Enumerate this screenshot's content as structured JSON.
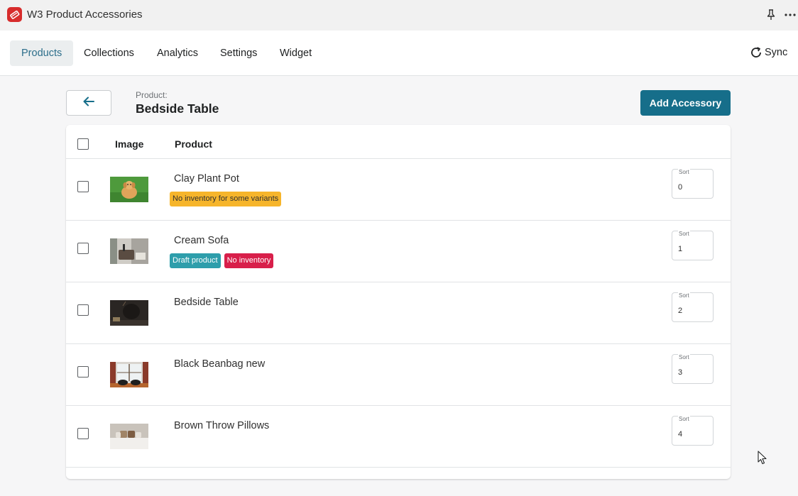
{
  "app": {
    "title": "W3 Product Accessories",
    "logo_icon": "app-logo-icon"
  },
  "nav": {
    "tabs": [
      {
        "label": "Products",
        "active": true
      },
      {
        "label": "Collections",
        "active": false
      },
      {
        "label": "Analytics",
        "active": false
      },
      {
        "label": "Settings",
        "active": false
      },
      {
        "label": "Widget",
        "active": false
      }
    ],
    "sync_label": "Sync"
  },
  "header": {
    "caption": "Product:",
    "title": "Bedside Table",
    "add_button": "Add Accessory"
  },
  "table": {
    "columns": {
      "image": "Image",
      "product": "Product"
    },
    "sort_label": "Sort",
    "rows": [
      {
        "name": "Clay Plant Pot",
        "badges": [
          "No inventory for some variants"
        ],
        "sort": "0",
        "thumb": "puppy-photo"
      },
      {
        "name": "Cream Sofa",
        "badges": [
          "Draft product",
          "No inventory"
        ],
        "sort": "1",
        "thumb": "living-room-photo"
      },
      {
        "name": "Bedside Table",
        "badges": [],
        "sort": "2",
        "thumb": "dark-room-photo"
      },
      {
        "name": "Black Beanbag new",
        "badges": [],
        "sort": "3",
        "thumb": "window-room-photo"
      },
      {
        "name": "Brown Throw Pillows",
        "badges": [],
        "sort": "4",
        "thumb": "bed-pillows-photo"
      }
    ]
  },
  "colors": {
    "primary": "#166e8a",
    "active_tab_text": "#2c6e8a",
    "badge_warning": "#f6b52b",
    "badge_draft": "#2e9eab",
    "badge_critical": "#d81f4a"
  }
}
